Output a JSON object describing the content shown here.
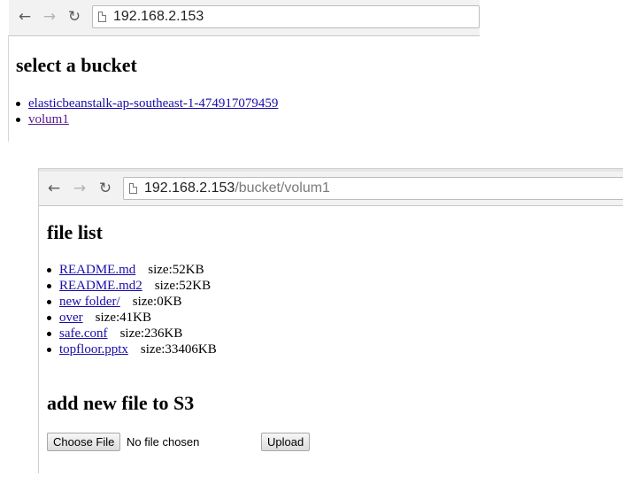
{
  "window1": {
    "url_host": "192.168.2.153",
    "heading": "select a bucket",
    "buckets": [
      {
        "name": "elasticbeanstalk-ap-southeast-1-474917079459"
      },
      {
        "name": "volum1"
      }
    ]
  },
  "window2": {
    "url_host": "192.168.2.153",
    "url_path": "/bucket/volum1",
    "heading": "file list",
    "files": [
      {
        "name": "README.md",
        "size": "size:52KB"
      },
      {
        "name": "README.md2",
        "size": "size:52KB"
      },
      {
        "name": "new folder/",
        "size": "size:0KB"
      },
      {
        "name": "over",
        "size": "size:41KB"
      },
      {
        "name": "safe.conf",
        "size": "size:236KB"
      },
      {
        "name": "topfloor.pptx",
        "size": "size:33406KB"
      }
    ],
    "upload_heading": "add new file to S3",
    "choose_file_label": "Choose File",
    "no_file_text": "No file chosen",
    "upload_label": "Upload"
  },
  "icons": {
    "back": "arrow-left-icon",
    "forward": "arrow-right-icon",
    "reload": "reload-icon",
    "page": "page-icon"
  },
  "colors": {
    "link": "#1a0dab",
    "visited_link": "#551a8b",
    "toolbar": "#f2f2f2"
  }
}
